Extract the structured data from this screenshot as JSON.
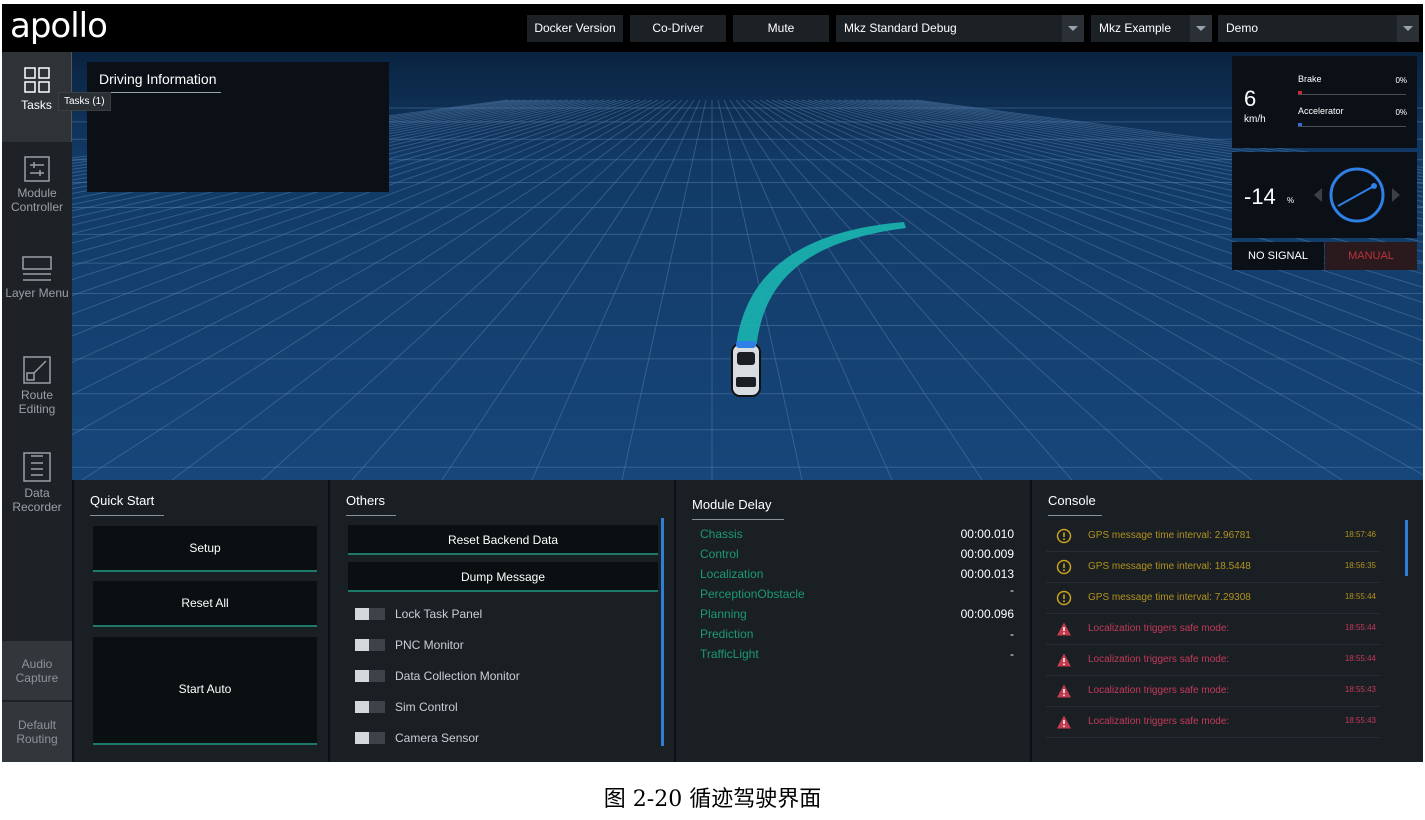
{
  "app": {
    "logo": "apollo"
  },
  "topbar": {
    "docker_label": "Docker Version",
    "codriver_label": "Co-Driver",
    "mute_label": "Mute",
    "mode_select": "Mkz Standard Debug",
    "vehicle_select": "Mkz Example",
    "map_select": "Demo"
  },
  "sidebar": {
    "items": [
      {
        "label": "Tasks"
      },
      {
        "label": "Module Controller"
      },
      {
        "label": "Layer Menu"
      },
      {
        "label": "Route Editing"
      },
      {
        "label": "Data Recorder"
      }
    ],
    "bottom": [
      {
        "label": "Audio Capture"
      },
      {
        "label": "Default Routing"
      }
    ],
    "tooltip": "Tasks (1)"
  },
  "scene": {
    "driving_info_title": "Driving Information"
  },
  "dashboard": {
    "speed": "6",
    "speed_unit": "km/h",
    "brake_label": "Brake",
    "brake_value": "0%",
    "accelerator_label": "Accelerator",
    "accelerator_value": "0%",
    "steering": "-14",
    "steering_unit": "%",
    "signal": "NO SIGNAL",
    "drive_mode": "MANUAL",
    "colors": {
      "brake": "#d3263a",
      "accelerator": "#2f6fd6",
      "steering_ring": "#2f7fe6"
    }
  },
  "quick_start": {
    "title": "Quick Start",
    "buttons": [
      "Setup",
      "Reset All",
      "Start Auto"
    ]
  },
  "others": {
    "title": "Others",
    "buttons": [
      "Reset Backend Data",
      "Dump Message"
    ],
    "toggles": [
      "Lock Task Panel",
      "PNC Monitor",
      "Data Collection Monitor",
      "Sim Control",
      "Camera Sensor"
    ]
  },
  "module_delay": {
    "title": "Module Delay",
    "rows": [
      {
        "name": "Chassis",
        "value": "00:00.010"
      },
      {
        "name": "Control",
        "value": "00:00.009"
      },
      {
        "name": "Localization",
        "value": "00:00.013"
      },
      {
        "name": "PerceptionObstacle",
        "value": "-"
      },
      {
        "name": "Planning",
        "value": "00:00.096"
      },
      {
        "name": "Prediction",
        "value": "-"
      },
      {
        "name": "TrafficLight",
        "value": "-"
      }
    ]
  },
  "console": {
    "title": "Console",
    "rows": [
      {
        "level": "warning",
        "icon": "warning-circle-icon",
        "message": "GPS message time interval: 2.96781",
        "time": "18:57:46"
      },
      {
        "level": "warning",
        "icon": "warning-circle-icon",
        "message": "GPS message time interval: 18.5448",
        "time": "18:56:35"
      },
      {
        "level": "warning",
        "icon": "warning-circle-icon",
        "message": "GPS message time interval: 7.29308",
        "time": "18:55:44"
      },
      {
        "level": "error",
        "icon": "error-triangle-icon",
        "message": "Localization triggers safe mode:",
        "time": "18:55:44"
      },
      {
        "level": "error",
        "icon": "error-triangle-icon",
        "message": "Localization triggers safe mode:",
        "time": "18:55:44"
      },
      {
        "level": "error",
        "icon": "error-triangle-icon",
        "message": "Localization triggers safe mode:",
        "time": "18:55:43"
      },
      {
        "level": "error",
        "icon": "error-triangle-icon",
        "message": "Localization triggers safe mode:",
        "time": "18:55:43"
      }
    ]
  },
  "caption": "图 2-20 循迹驾驶界面"
}
